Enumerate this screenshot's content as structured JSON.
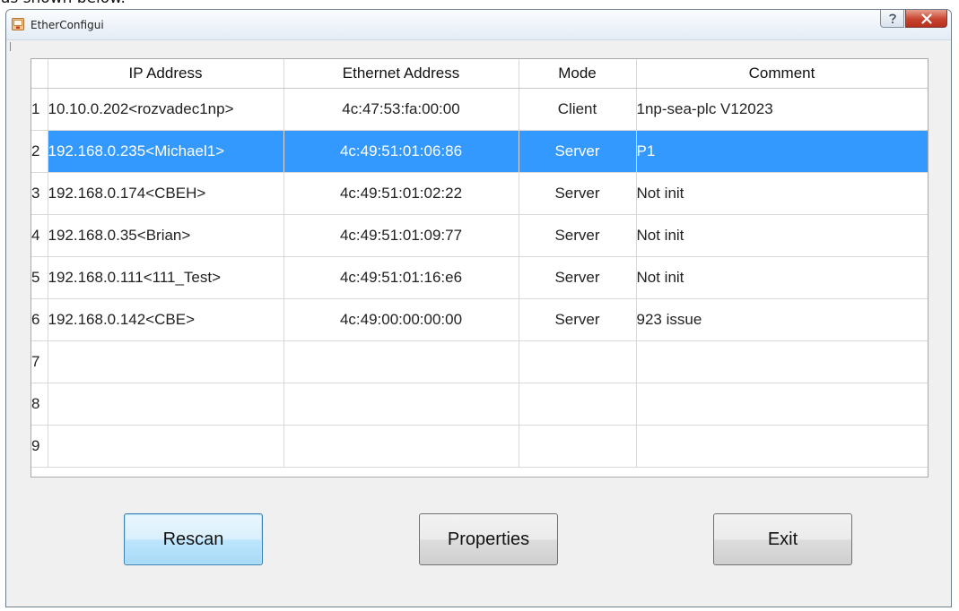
{
  "above_text": "as shown below.",
  "window": {
    "title": "EtherConfigui",
    "help_symbol": "?",
    "close_symbol": "x"
  },
  "table": {
    "columns": [
      "IP Address",
      "Ethernet Address",
      "Mode",
      "Comment"
    ],
    "rows": [
      {
        "num": "1",
        "ip": "10.10.0.202<rozvadec1np>",
        "eth": "4c:47:53:fa:00:00",
        "mode": "Client",
        "comment": "1np-sea-plc V12023",
        "selected": false
      },
      {
        "num": "2",
        "ip": "192.168.0.235<Michael1>",
        "eth": "4c:49:51:01:06:86",
        "mode": "Server",
        "comment": "P1",
        "selected": true
      },
      {
        "num": "3",
        "ip": "192.168.0.174<CBEH>",
        "eth": "4c:49:51:01:02:22",
        "mode": "Server",
        "comment": "Not init",
        "selected": false
      },
      {
        "num": "4",
        "ip": "192.168.0.35<Brian>",
        "eth": "4c:49:51:01:09:77",
        "mode": "Server",
        "comment": "Not init",
        "selected": false
      },
      {
        "num": "5",
        "ip": "192.168.0.111<111_Test>",
        "eth": "4c:49:51:01:16:e6",
        "mode": "Server",
        "comment": "Not init",
        "selected": false
      },
      {
        "num": "6",
        "ip": "192.168.0.142<CBE>",
        "eth": "4c:49:00:00:00:00",
        "mode": "Server",
        "comment": "923 issue",
        "selected": false
      },
      {
        "num": "7",
        "ip": "",
        "eth": "",
        "mode": "",
        "comment": "",
        "selected": false
      },
      {
        "num": "8",
        "ip": "",
        "eth": "",
        "mode": "",
        "comment": "",
        "selected": false
      },
      {
        "num": "9",
        "ip": "",
        "eth": "",
        "mode": "",
        "comment": "",
        "selected": false
      }
    ]
  },
  "buttons": {
    "rescan": "Rescan",
    "properties": "Properties",
    "exit": "Exit"
  },
  "colors": {
    "selection": "#3399ff",
    "window_bg": "#f0f0f0"
  },
  "icons": {
    "app": "app-window-icon",
    "help": "help-icon",
    "close": "close-icon"
  }
}
